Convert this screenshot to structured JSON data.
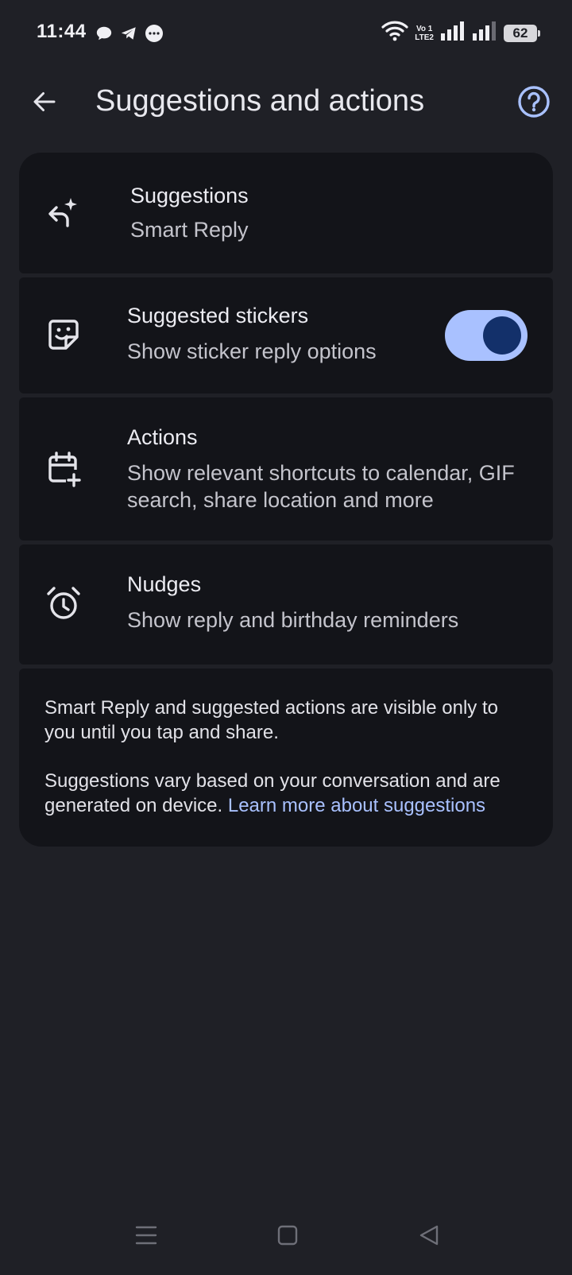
{
  "status_bar": {
    "time": "11:44",
    "volte_top": "Vo 1",
    "volte_bottom": "LTE2",
    "battery": "62"
  },
  "header": {
    "title": "Suggestions and actions"
  },
  "settings": [
    {
      "title": "Suggestions",
      "subtitle": "Smart Reply",
      "icon": "reply-sparkle-icon"
    },
    {
      "title": "Suggested stickers",
      "subtitle": "Show sticker reply options",
      "icon": "sticker-icon",
      "toggle_on": true
    },
    {
      "title": "Actions",
      "subtitle": "Show relevant shortcuts to calendar, GIF search, share location and more",
      "icon": "calendar-add-icon"
    },
    {
      "title": "Nudges",
      "subtitle": "Show reply and birthday reminders",
      "icon": "alarm-clock-icon"
    }
  ],
  "info": {
    "paragraph1": "Smart Reply and suggested actions are visible only to you until you tap and share.",
    "paragraph2_prefix": "Suggestions vary based on your conversation and are generated on device. ",
    "learn_more_link": "Learn more about suggestions"
  },
  "colors": {
    "background": "#1f2026",
    "card": "#131419",
    "accent": "#a9c1ff",
    "toggle_knob": "#13306a"
  }
}
